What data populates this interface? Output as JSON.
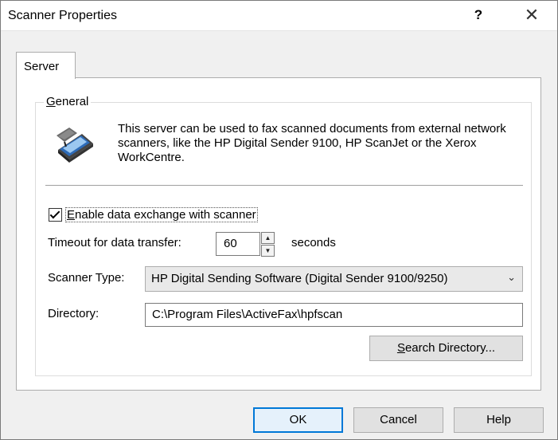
{
  "window": {
    "title": "Scanner Properties"
  },
  "titlebar": {
    "help_glyph": "?",
    "close_glyph": "✕"
  },
  "tabs": [
    {
      "label": "Server",
      "selected": true
    }
  ],
  "group": {
    "label_accel": "G",
    "label_rest": "eneral",
    "icon": "scanner-icon",
    "description": "This server can be used to fax scanned documents from external network scanners, like the HP Digital Sender 9100, HP ScanJet or the Xerox WorkCentre."
  },
  "enable": {
    "checked": true,
    "label_accel": "E",
    "label_rest": "nable data exchange with scanner"
  },
  "timeout": {
    "label": "Timeout for data transfer:",
    "value": "60",
    "unit": "seconds"
  },
  "scanner_type": {
    "label": "Scanner Type:",
    "selected": "HP Digital Sending Software (Digital Sender 9100/9250)"
  },
  "directory": {
    "label": "Directory:",
    "value": "C:\\Program Files\\ActiveFax\\hpfscan"
  },
  "search_button": {
    "label_accel": "S",
    "label_rest": "earch Directory..."
  },
  "footer": {
    "ok": "OK",
    "cancel": "Cancel",
    "help": "Help"
  },
  "colors": {
    "accent": "#0078d7",
    "scanner_glass": "#2d6bb8"
  }
}
